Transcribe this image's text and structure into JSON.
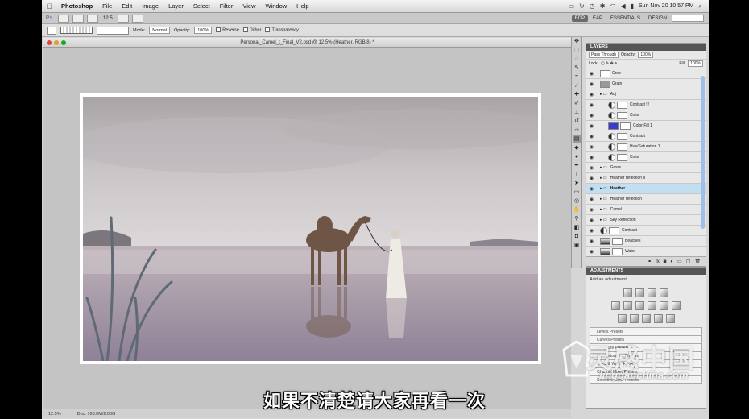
{
  "menubar": {
    "app": "Photoshop",
    "items": [
      "File",
      "Edit",
      "Image",
      "Layer",
      "Select",
      "Filter",
      "View",
      "Window",
      "Help"
    ],
    "clock": "Sun Nov 20   10:57 PM"
  },
  "appbar": {
    "ps": "Ps",
    "zoom": "12.5",
    "workspaces": [
      "EDP",
      "EAP",
      "ESSENTIALS",
      "DESIGN"
    ]
  },
  "options": {
    "mode_label": "Mode:",
    "mode_value": "Normal",
    "opacity_label": "Opacity:",
    "opacity_value": "100%",
    "reverse": "Reverse",
    "dither": "Dither",
    "transparency": "Transparency"
  },
  "document": {
    "title": "Personal_Camel_t_Final_V2.psd @ 12.5% (Heather, RGB/8) *",
    "zoom": "12.5%",
    "doc_info": "Doc: 168.0M/2.00G"
  },
  "layers_panel": {
    "tab": "LAYERS",
    "blend": "Pass Through",
    "opacity_label": "Opacity:",
    "opacity_value": "100%",
    "lock_label": "Lock:",
    "fill_label": "Fill:",
    "fill_value": "100%",
    "layers": [
      {
        "name": "Crop",
        "indent": 0,
        "type": "plain"
      },
      {
        "name": "Grain",
        "indent": 0,
        "type": "gray"
      },
      {
        "name": "Adj",
        "indent": 0,
        "type": "group"
      },
      {
        "name": "Contrast !!!",
        "indent": 1,
        "type": "adj"
      },
      {
        "name": "Color",
        "indent": 1,
        "type": "adj"
      },
      {
        "name": "Color Fill 1",
        "indent": 1,
        "type": "fill"
      },
      {
        "name": "Contrast",
        "indent": 1,
        "type": "adj"
      },
      {
        "name": "Hue/Saturation 1",
        "indent": 1,
        "type": "adj"
      },
      {
        "name": "Color",
        "indent": 1,
        "type": "adj"
      },
      {
        "name": "Grass",
        "indent": 0,
        "type": "group"
      },
      {
        "name": "Heather reflection II",
        "indent": 0,
        "type": "group"
      },
      {
        "name": "Heather",
        "indent": 0,
        "type": "group",
        "selected": true
      },
      {
        "name": "Heather reflection",
        "indent": 0,
        "type": "group"
      },
      {
        "name": "Camel",
        "indent": 0,
        "type": "group"
      },
      {
        "name": "Sky Reflection",
        "indent": 0,
        "type": "group"
      },
      {
        "name": "Contrast",
        "indent": 0,
        "type": "adj"
      },
      {
        "name": "Beaches",
        "indent": 0,
        "type": "image"
      },
      {
        "name": "Water",
        "indent": 0,
        "type": "image"
      }
    ]
  },
  "adjustments_panel": {
    "tab": "ADJUSTMENTS",
    "subtitle": "Add an adjustment",
    "presets": [
      "Levels Presets",
      "Curves Presets",
      "Exposure Presets",
      "Hue/Saturation Presets",
      "Black & White Presets",
      "Channel Mixer Presets",
      "Selective Color Presets"
    ]
  },
  "subtitle": "如果不清楚请大家再看一次",
  "watermark": {
    "cn": "灵感中国",
    "en": "lingganchina.com"
  },
  "colors": {
    "selected_layer": "#c2dff2",
    "panel_tab": "#555555"
  }
}
